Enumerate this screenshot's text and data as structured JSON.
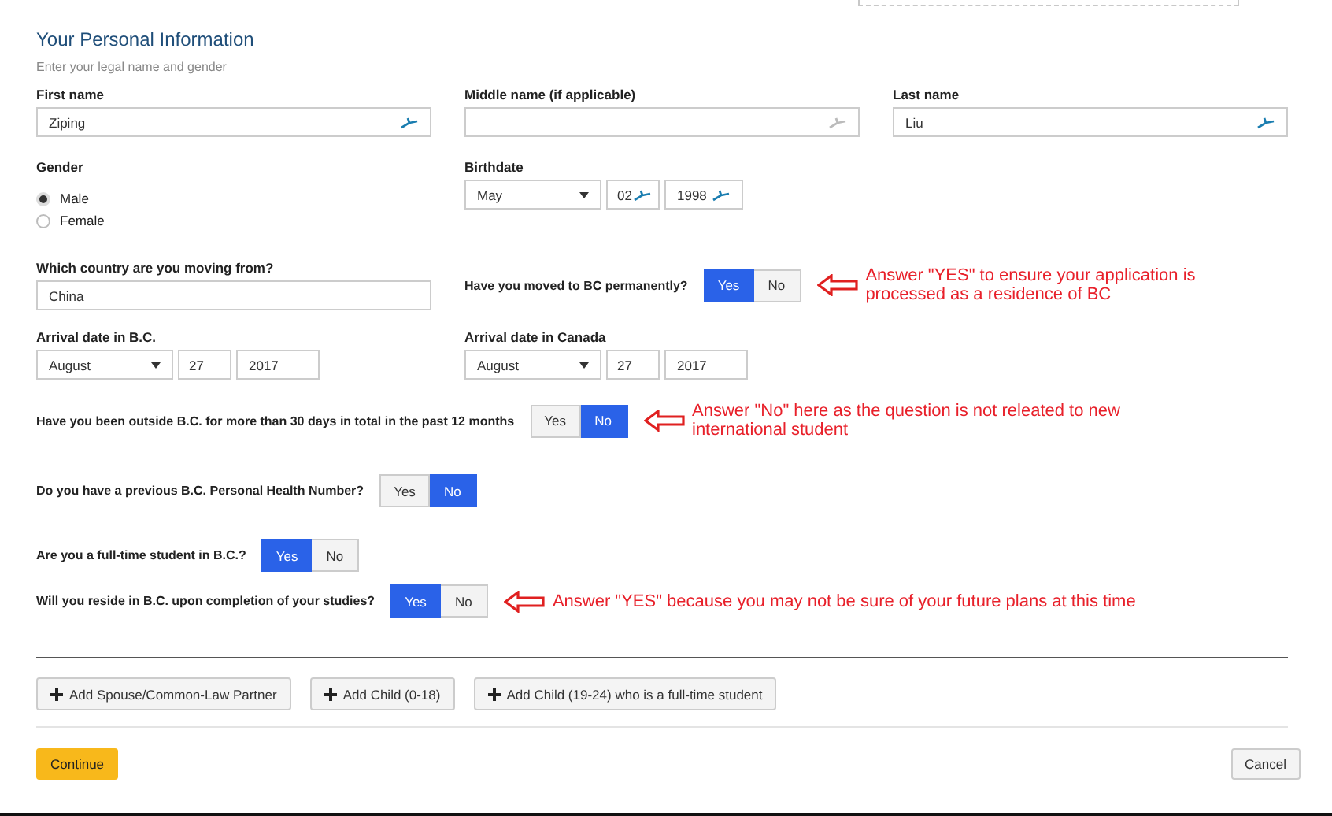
{
  "heading": "Your Personal Information",
  "subheading": "Enter your legal name and gender",
  "name_fields": [
    {
      "label": "First name",
      "value": "Ziping"
    },
    {
      "label": "Middle name (if applicable)"
    },
    {
      "label": "Last name",
      "value": "Liu"
    }
  ],
  "gender": {
    "label": "Gender",
    "options": [
      {
        "label": "Male",
        "selected": true
      },
      {
        "label": "Female",
        "selected": false
      }
    ]
  },
  "birthdate": {
    "label": "Birthdate",
    "month": "May",
    "day": "02",
    "year": "1998"
  },
  "country": {
    "label": "Which country are you moving from?",
    "value": "China"
  },
  "permanent": {
    "question": "Have you moved to BC permanently?",
    "options": [
      {
        "label": "Yes",
        "selected": true
      },
      {
        "label": "No",
        "selected": false
      }
    ],
    "annotation": "Answer \"YES\" to ensure your application is processed as a residence of BC"
  },
  "arrival_dates": [
    {
      "label": "Arrival date in B.C.",
      "month": "August",
      "day": "27",
      "year": "2017"
    },
    {
      "label": "Arrival date in Canada",
      "month": "August",
      "day": "27",
      "year": "2017"
    }
  ],
  "questions": [
    {
      "question": "Have you been outside B.C. for more than 30 days in total in the past 12 months",
      "options": [
        {
          "label": "Yes",
          "selected": false
        },
        {
          "label": "No",
          "selected": true
        }
      ],
      "annotation": "Answer \"No\" here as the question is not releated to new international student"
    },
    {
      "question": "Do you have a previous B.C. Personal Health Number?",
      "options": [
        {
          "label": "Yes",
          "selected": false
        },
        {
          "label": "No",
          "selected": true
        }
      ]
    },
    {
      "question": "Are you a full-time student in B.C.?",
      "options": [
        {
          "label": "Yes",
          "selected": true
        },
        {
          "label": "No",
          "selected": false
        }
      ]
    },
    {
      "question": "Will you reside in B.C. upon completion of your studies?",
      "options": [
        {
          "label": "Yes",
          "selected": true
        },
        {
          "label": "No",
          "selected": false
        }
      ],
      "annotation": "Answer \"YES\" because you may not be sure of your future plans at this time"
    }
  ],
  "add_buttons": [
    "Add Spouse/Common-Law Partner",
    "Add Child (0-18)",
    "Add Child (19-24) who is a full-time student"
  ],
  "continue_button": "Continue",
  "cancel_button": "Cancel"
}
